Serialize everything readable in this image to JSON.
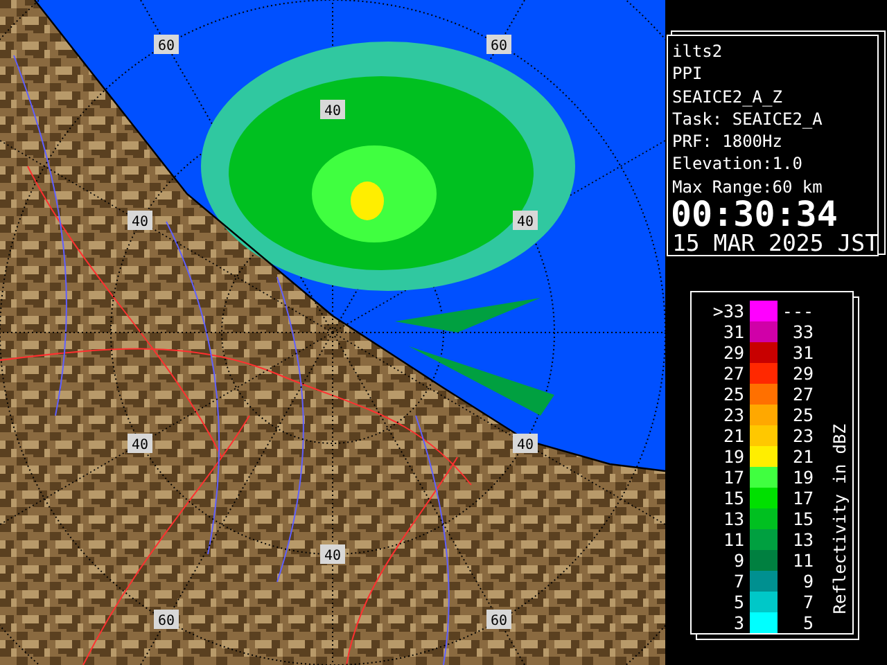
{
  "map": {
    "range_labels": [
      "60",
      "60",
      "40",
      "40",
      "40",
      "40",
      "40",
      "40",
      "60",
      "60"
    ]
  },
  "info": {
    "lines": [
      "ilts2",
      "PPI",
      "SEAICE2_A_Z",
      "Task: SEAICE2_A",
      "PRF: 1800Hz",
      "Elevation:1.0",
      "Max Range:60 km"
    ],
    "time": "00:30:34",
    "date": "15 MAR 2025 JST"
  },
  "legend": {
    "title": "Reflectivity in dBZ",
    "rows": [
      {
        "low": ">33",
        "high": "---",
        "color": "#ff00ff"
      },
      {
        "low": "31",
        "high": "33",
        "color": "#d000a8"
      },
      {
        "low": "29",
        "high": "31",
        "color": "#c80000"
      },
      {
        "low": "27",
        "high": "29",
        "color": "#ff2800"
      },
      {
        "low": "25",
        "high": "27",
        "color": "#ff7000"
      },
      {
        "low": "23",
        "high": "25",
        "color": "#ffa800"
      },
      {
        "low": "21",
        "high": "23",
        "color": "#ffc800"
      },
      {
        "low": "19",
        "high": "21",
        "color": "#ffee00"
      },
      {
        "low": "17",
        "high": "19",
        "color": "#40ff40"
      },
      {
        "low": "15",
        "high": "17",
        "color": "#00e000"
      },
      {
        "low": "13",
        "high": "15",
        "color": "#00c020"
      },
      {
        "low": "11",
        "high": "13",
        "color": "#00a040"
      },
      {
        "low": "9",
        "high": "11",
        "color": "#008040"
      },
      {
        "low": "7",
        "high": "9",
        "color": "#009090"
      },
      {
        "low": "5",
        "high": "7",
        "color": "#00c8c8"
      },
      {
        "low": "3",
        "high": "5",
        "color": "#00ffff"
      }
    ]
  }
}
